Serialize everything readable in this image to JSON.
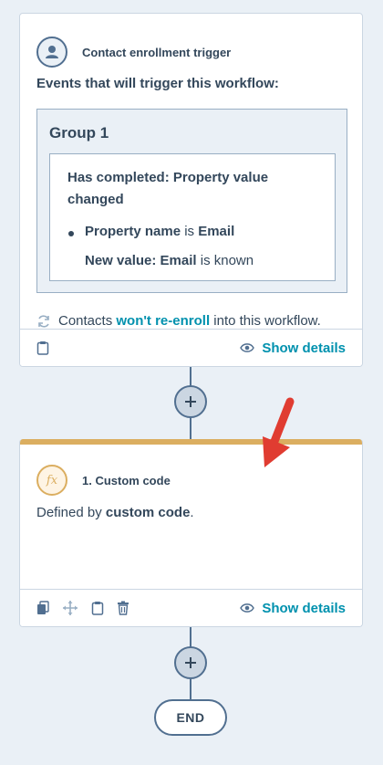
{
  "trigger": {
    "title": "Contact enrollment trigger",
    "section_title": "Events that will trigger this workflow:",
    "group_title": "Group 1",
    "filter_heading": "Has completed: Property value changed",
    "filter_property_label": "Property name",
    "filter_property_connector": " is ",
    "filter_property_value": "Email",
    "filter_new_value_label": "New value: Email",
    "filter_new_value_suffix": " is known",
    "reenroll_prefix": "Contacts ",
    "reenroll_link": "won't re-enroll",
    "reenroll_suffix": " into this workflow.",
    "show_details": "Show details",
    "icon": "contact-person-icon"
  },
  "action": {
    "title": "1. Custom code",
    "body_prefix": "Defined by ",
    "body_bold": "custom code",
    "body_suffix": ".",
    "show_details": "Show details",
    "icon_text": "fx"
  },
  "end_label": "END",
  "colors": {
    "background": "#eaf0f6",
    "text": "#33475b",
    "link": "#0091ae",
    "action_accent": "#dbae60",
    "arrow": "#e03c31"
  }
}
